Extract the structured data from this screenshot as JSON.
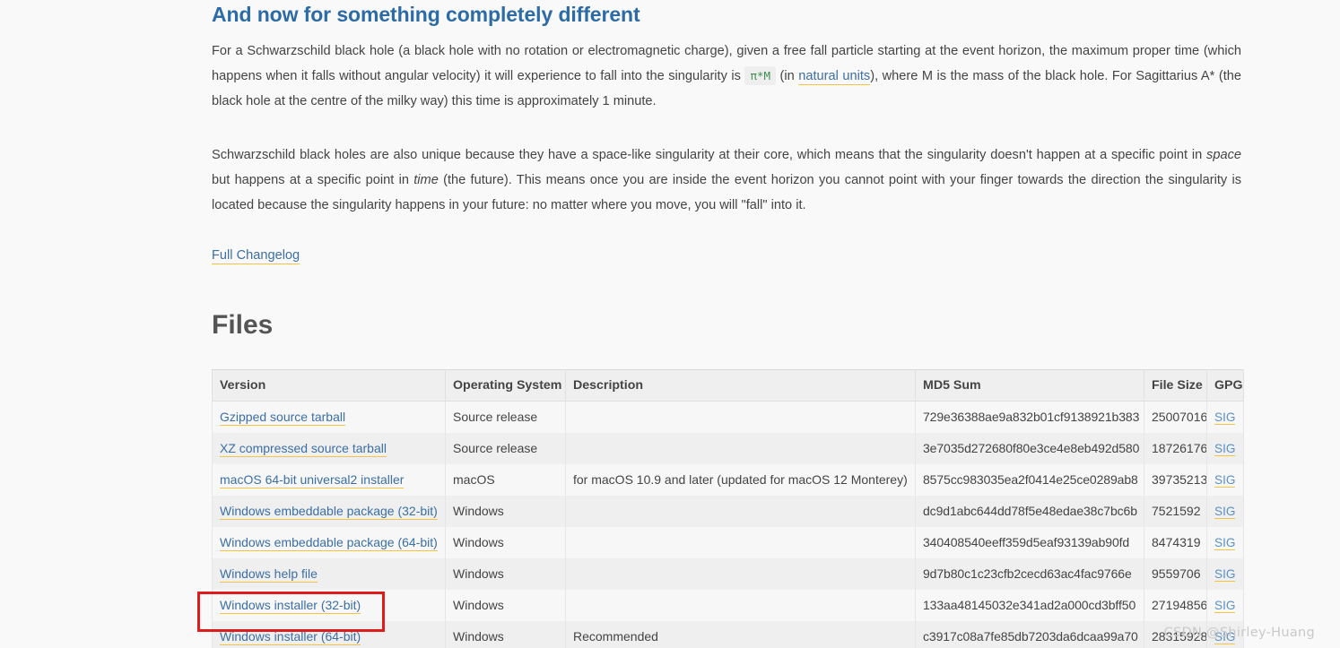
{
  "article": {
    "heading": "And now for something completely different",
    "paragraph1": {
      "part1": "For a Schwarzschild black hole (a black hole with no rotation or electromagnetic charge), given a free fall particle starting at the event horizon, the maximum proper time (which happens when it falls without angular velocity) it will experience to fall into the singularity is ",
      "code": "π*M",
      "part2": " (in ",
      "link_text": "natural units",
      "part3": "), where M is the mass of the black hole. For Sagittarius A* (the black hole at the centre of the milky way) this time is approximately 1 minute."
    },
    "paragraph2": {
      "part1": "Schwarzschild black holes are also unique because they have a space-like singularity at their core, which means that the singularity doesn't happen at a specific point in ",
      "em1": "space",
      "part2": " but happens at a specific point in ",
      "em2": "time",
      "part3": " (the future). This means once you are inside the event horizon you cannot point with your finger towards the direction the singularity is located because the singularity happens in your future: no matter where you move, you will \"fall\" into it."
    },
    "changelog_link": "Full Changelog"
  },
  "files": {
    "title": "Files",
    "columns": [
      "Version",
      "Operating System",
      "Description",
      "MD5 Sum",
      "File Size",
      "GPG"
    ],
    "rows": [
      {
        "version": "Gzipped source tarball",
        "os": "Source release",
        "description": "",
        "md5": "729e36388ae9a832b01cf9138921b383",
        "size": "25007016",
        "gpg": "SIG"
      },
      {
        "version": "XZ compressed source tarball",
        "os": "Source release",
        "description": "",
        "md5": "3e7035d272680f80e3ce4e8eb492d580",
        "size": "18726176",
        "gpg": "SIG"
      },
      {
        "version": "macOS 64-bit universal2 installer",
        "os": "macOS",
        "description": "for macOS 10.9 and later (updated for macOS 12 Monterey)",
        "md5": "8575cc983035ea2f0414e25ce0289ab8",
        "size": "39735213",
        "gpg": "SIG"
      },
      {
        "version": "Windows embeddable package (32-bit)",
        "os": "Windows",
        "description": "",
        "md5": "dc9d1abc644dd78f5e48edae38c7bc6b",
        "size": "7521592",
        "gpg": "SIG"
      },
      {
        "version": "Windows embeddable package (64-bit)",
        "os": "Windows",
        "description": "",
        "md5": "340408540eeff359d5eaf93139ab90fd",
        "size": "8474319",
        "gpg": "SIG"
      },
      {
        "version": "Windows help file",
        "os": "Windows",
        "description": "",
        "md5": "9d7b80c1c23cfb2cecd63ac4fac9766e",
        "size": "9559706",
        "gpg": "SIG"
      },
      {
        "version": "Windows installer (32-bit)",
        "os": "Windows",
        "description": "",
        "md5": "133aa48145032e341ad2a000cd3bff50",
        "size": "27194856",
        "gpg": "SIG"
      },
      {
        "version": "Windows installer (64-bit)",
        "os": "Windows",
        "description": "Recommended",
        "md5": "c3917c08a7fe85db7203da6dcaa99a70",
        "size": "28315928",
        "gpg": "SIG"
      }
    ]
  },
  "annotation": {
    "highlighted_row_version": "Windows installer (64-bit)",
    "highlight_color": "#e01b1b"
  },
  "watermark": "CSDN @Shirley-Huang",
  "colors": {
    "heading": "#2c6ba5",
    "link": "#3b6fa5",
    "link_underline": "#f5c342",
    "code_text": "#3c8f4e",
    "code_bg": "#eeeeee",
    "page_bg": "#f9f9f9",
    "table_header_bg": "#efefef"
  }
}
